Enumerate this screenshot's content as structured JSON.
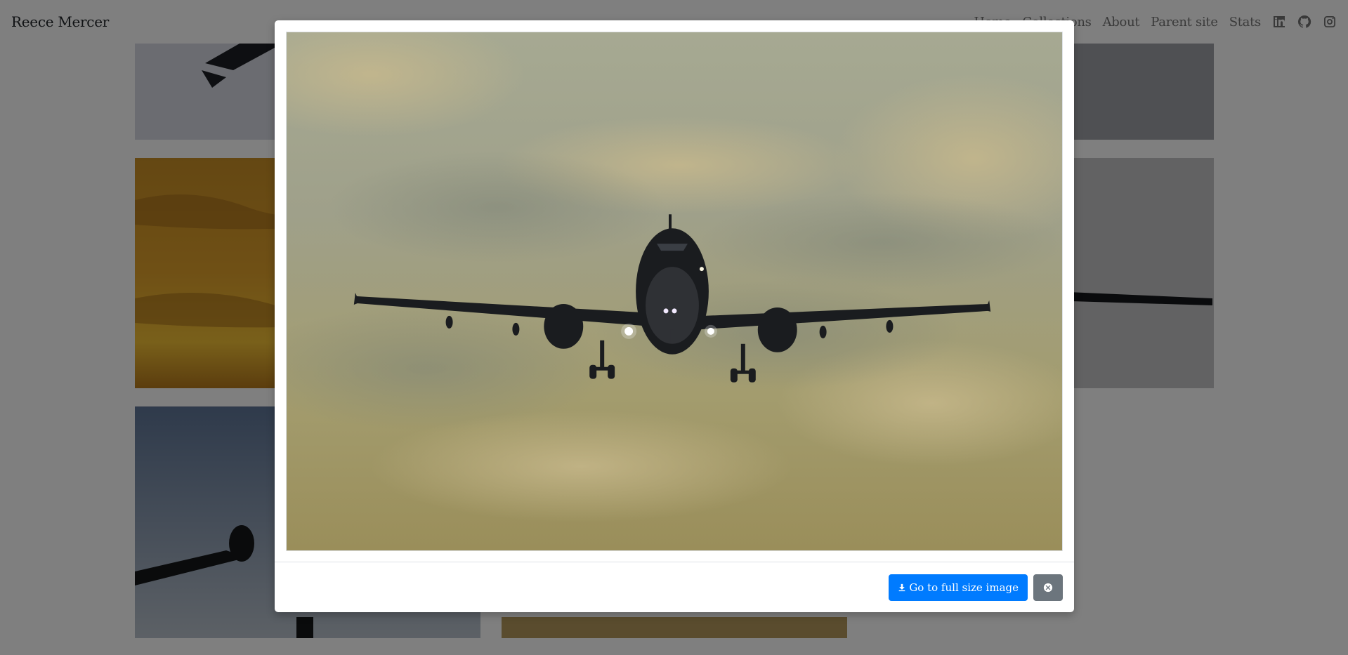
{
  "navbar": {
    "brand": "Reece Mercer",
    "links": [
      "Home",
      "Collections",
      "About",
      "Parent site",
      "Stats"
    ],
    "icons": [
      "linkedin-icon",
      "github-icon",
      "instagram-icon"
    ]
  },
  "gallery": {
    "tiles": [
      "airplane-photo",
      "sunset-sky-photo",
      "airplane-photo",
      "airplane-photo",
      "airplane-photo",
      "sky-photo"
    ]
  },
  "modal": {
    "image": "airplane-landing-photo",
    "download_label": "Go to full size image",
    "download_icon": "download-icon",
    "close_icon": "close-circle-icon"
  },
  "colors": {
    "primary": "#007bff",
    "secondary": "#6c757d",
    "backdrop": "rgba(0,0,0,0.5)"
  }
}
